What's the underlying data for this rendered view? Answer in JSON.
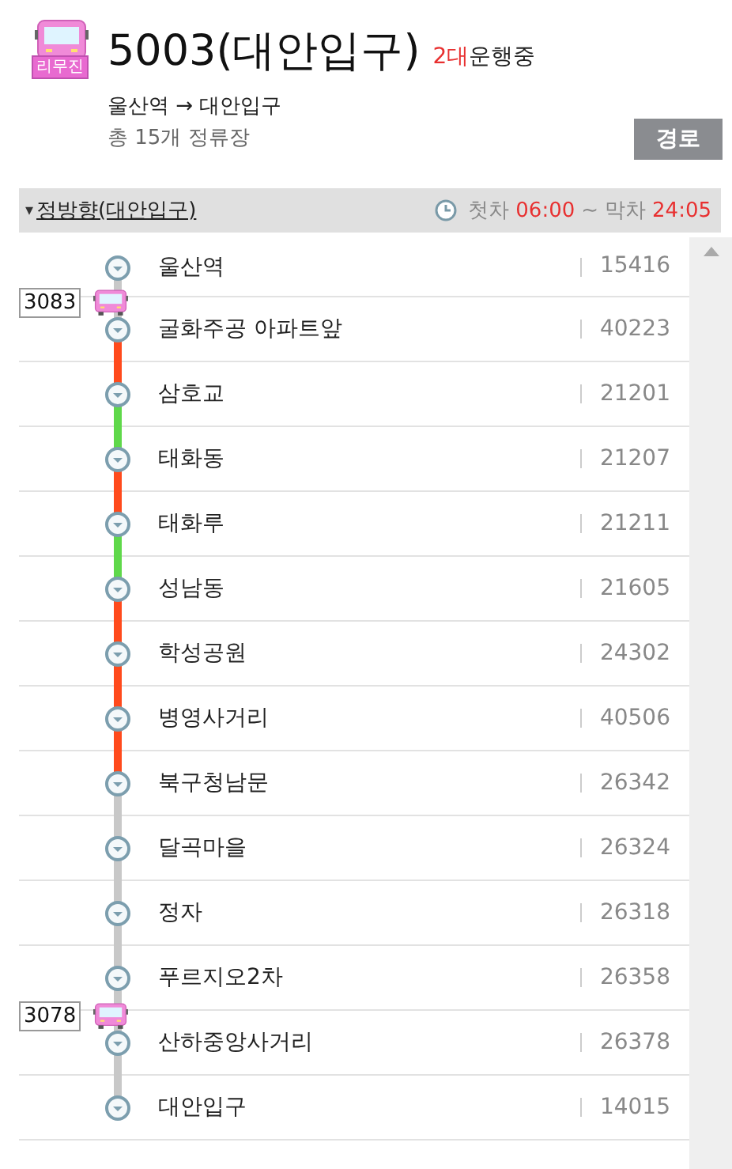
{
  "header": {
    "badge": "리무진",
    "title": "5003(대안입구)",
    "running_count": "2대",
    "running_label": "운행중",
    "route": "울산역 → 대안입구",
    "stop_total": "총 15개 정류장",
    "route_button": "경로"
  },
  "direction": {
    "caret": "▾",
    "label": "정방향(대안입구)",
    "first_label": "첫차",
    "first_time": "06:00",
    "separator": "~",
    "last_label": "막차",
    "last_time": "24:05"
  },
  "stops": [
    {
      "name": "울산역",
      "number": "15416",
      "color": "#c8c8c8",
      "bus": "3083"
    },
    {
      "name": "굴화주공 아파트앞",
      "number": "40223",
      "color": "#ff4a1c"
    },
    {
      "name": "삼호교",
      "number": "21201",
      "color": "#5fd84a"
    },
    {
      "name": "태화동",
      "number": "21207",
      "color": "#ff4a1c"
    },
    {
      "name": "태화루",
      "number": "21211",
      "color": "#5fd84a"
    },
    {
      "name": "성남동",
      "number": "21605",
      "color": "#ff4a1c"
    },
    {
      "name": "학성공원",
      "number": "24302",
      "color": "#ff4a1c"
    },
    {
      "name": "병영사거리",
      "number": "40506",
      "color": "#ff4a1c"
    },
    {
      "name": "북구청남문",
      "number": "26342",
      "color": "#c8c8c8"
    },
    {
      "name": "달곡마을",
      "number": "26324",
      "color": "#c8c8c8"
    },
    {
      "name": "정자",
      "number": "26318",
      "color": "#c8c8c8"
    },
    {
      "name": "푸르지오2차",
      "number": "26358",
      "color": "#c8c8c8",
      "bus": "3078"
    },
    {
      "name": "산하중앙사거리",
      "number": "26378",
      "color": "#c8c8c8"
    },
    {
      "name": "대안입구",
      "number": "14015"
    }
  ]
}
